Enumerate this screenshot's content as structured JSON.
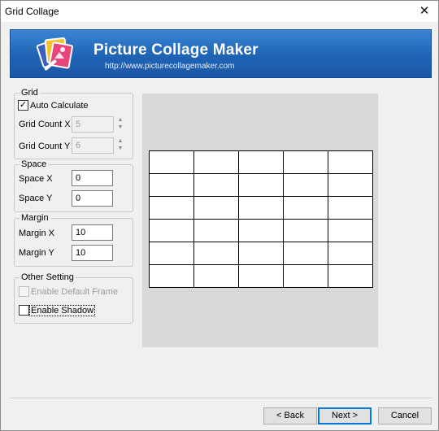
{
  "window": {
    "title": "Grid Collage",
    "close_glyph": "✕"
  },
  "banner": {
    "logo_icon": "photo-collage-logo-icon",
    "title": "Picture Collage Maker",
    "url": "http://www.picturecollagemaker.com",
    "colors": {
      "top": "#3a86d3",
      "bottom": "#1b58a5",
      "text": "#ffffff"
    }
  },
  "grid": {
    "legend": "Grid",
    "auto_calculate": {
      "label": "Auto Calculate",
      "checked": true,
      "check_glyph": "✓"
    },
    "count_x": {
      "label": "Grid Count X",
      "value": "5",
      "disabled": true
    },
    "count_y": {
      "label": "Grid Count Y",
      "value": "6",
      "disabled": true
    },
    "spin_up_glyph": "▲",
    "spin_down_glyph": "▼"
  },
  "space": {
    "legend": "Space",
    "x": {
      "label": "Space X",
      "value": "0"
    },
    "y": {
      "label": "Space Y",
      "value": "0"
    }
  },
  "margin": {
    "legend": "Margin",
    "x": {
      "label": "Margin X",
      "value": "10"
    },
    "y": {
      "label": "Margin Y",
      "value": "10"
    }
  },
  "other": {
    "legend": "Other Setting",
    "default_frame": {
      "label": "Enable Default Frame",
      "checked": false,
      "disabled": true
    },
    "shadow": {
      "label": "Enable Shadow",
      "checked": false,
      "focused": true
    }
  },
  "preview": {
    "columns": 5,
    "rows": 6,
    "background": "#d9d9d9"
  },
  "buttons": {
    "back": "< Back",
    "next": "Next >",
    "cancel": "Cancel"
  }
}
